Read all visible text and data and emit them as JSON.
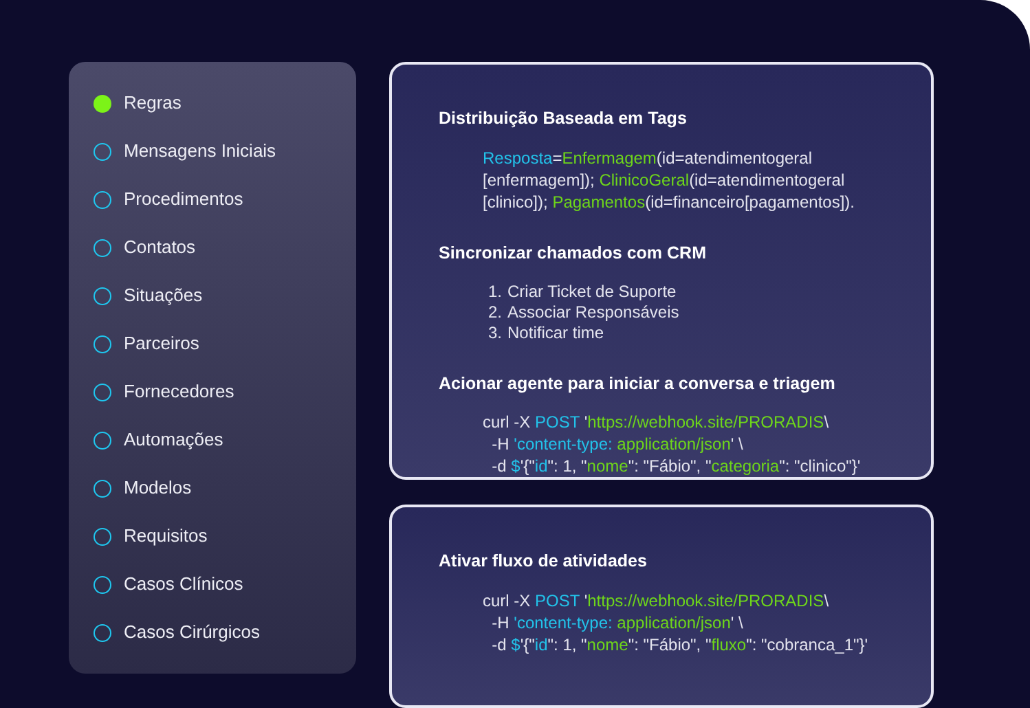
{
  "sidebar": {
    "items": [
      {
        "label": "Regras",
        "selected": true
      },
      {
        "label": "Mensagens Iniciais",
        "selected": false
      },
      {
        "label": "Procedimentos",
        "selected": false
      },
      {
        "label": "Contatos",
        "selected": false
      },
      {
        "label": "Situações",
        "selected": false
      },
      {
        "label": "Parceiros",
        "selected": false
      },
      {
        "label": "Fornecedores",
        "selected": false
      },
      {
        "label": "Automações",
        "selected": false
      },
      {
        "label": "Modelos",
        "selected": false
      },
      {
        "label": "Requisitos",
        "selected": false
      },
      {
        "label": "Casos Clínicos",
        "selected": false
      },
      {
        "label": "Casos Cirúrgicos",
        "selected": false
      }
    ]
  },
  "cards": [
    {
      "sections": [
        {
          "title": "Distribuição Baseada em Tags",
          "kind": "code",
          "lines": [
            [
              {
                "kind": "key",
                "text": "Resposta"
              },
              {
                "kind": "plain",
                "text": "="
              },
              {
                "kind": "value",
                "text": "Enfermagem"
              },
              {
                "kind": "plain",
                "text": "(id=atendimentogeral"
              }
            ],
            [
              {
                "kind": "plain",
                "text": "[enfermagem]); "
              },
              {
                "kind": "value",
                "text": "ClinicoGeral"
              },
              {
                "kind": "plain",
                "text": "(id=atendimentogeral"
              }
            ],
            [
              {
                "kind": "plain",
                "text": "[clinico]); "
              },
              {
                "kind": "value",
                "text": "Pagamentos"
              },
              {
                "kind": "plain",
                "text": "(id=financeiro[pagamentos])."
              }
            ]
          ]
        },
        {
          "title": "Sincronizar chamados com CRM",
          "kind": "list",
          "items": [
            {
              "number": "1.",
              "text": "Criar Ticket de Suporte"
            },
            {
              "number": "2.",
              "text": "Associar Responsáveis"
            },
            {
              "number": "3.",
              "text": "Notificar time"
            }
          ]
        },
        {
          "title": "Acionar agente para iniciar a conversa e triagem",
          "kind": "code",
          "lines": [
            [
              {
                "kind": "plain",
                "text": "curl -X "
              },
              {
                "kind": "key",
                "text": "POST"
              },
              {
                "kind": "plain",
                "text": " '"
              },
              {
                "kind": "value",
                "text": "https://webhook.site/PRORADIS"
              },
              {
                "kind": "plain",
                "text": "\\"
              }
            ],
            [
              {
                "kind": "plain",
                "text": "  -H "
              },
              {
                "kind": "key",
                "text": "'content-type:"
              },
              {
                "kind": "value",
                "text": " application/json"
              },
              {
                "kind": "plain",
                "text": "' \\"
              }
            ],
            [
              {
                "kind": "plain",
                "text": "  -d "
              },
              {
                "kind": "key",
                "text": "$"
              },
              {
                "kind": "plain",
                "text": "'{\""
              },
              {
                "kind": "key",
                "text": "id"
              },
              {
                "kind": "plain",
                "text": "\": 1, \""
              },
              {
                "kind": "value",
                "text": "nome"
              },
              {
                "kind": "plain",
                "text": "\": \"Fábio\", \""
              },
              {
                "kind": "value",
                "text": "categoria"
              },
              {
                "kind": "plain",
                "text": "\": \"clinico\"}'"
              }
            ]
          ]
        }
      ]
    },
    {
      "sections": [
        {
          "title": "Ativar fluxo de atividades",
          "kind": "code",
          "lines": [
            [
              {
                "kind": "plain",
                "text": "curl -X "
              },
              {
                "kind": "key",
                "text": "POST"
              },
              {
                "kind": "plain",
                "text": " '"
              },
              {
                "kind": "value",
                "text": "https://webhook.site/PRORADIS"
              },
              {
                "kind": "plain",
                "text": "\\"
              }
            ],
            [
              {
                "kind": "plain",
                "text": "  -H "
              },
              {
                "kind": "key",
                "text": "'content-type:"
              },
              {
                "kind": "value",
                "text": " application/json"
              },
              {
                "kind": "plain",
                "text": "' \\"
              }
            ],
            [
              {
                "kind": "plain",
                "text": "  -d "
              },
              {
                "kind": "key",
                "text": "$"
              },
              {
                "kind": "plain",
                "text": "'{\""
              },
              {
                "kind": "key",
                "text": "id"
              },
              {
                "kind": "plain",
                "text": "\": 1, \""
              },
              {
                "kind": "value",
                "text": "nome"
              },
              {
                "kind": "plain",
                "text": "\": \"Fábio\", \""
              },
              {
                "kind": "value",
                "text": "fluxo"
              },
              {
                "kind": "plain",
                "text": "\": \"cobranca_1\"}'"
              }
            ]
          ]
        }
      ]
    }
  ]
}
